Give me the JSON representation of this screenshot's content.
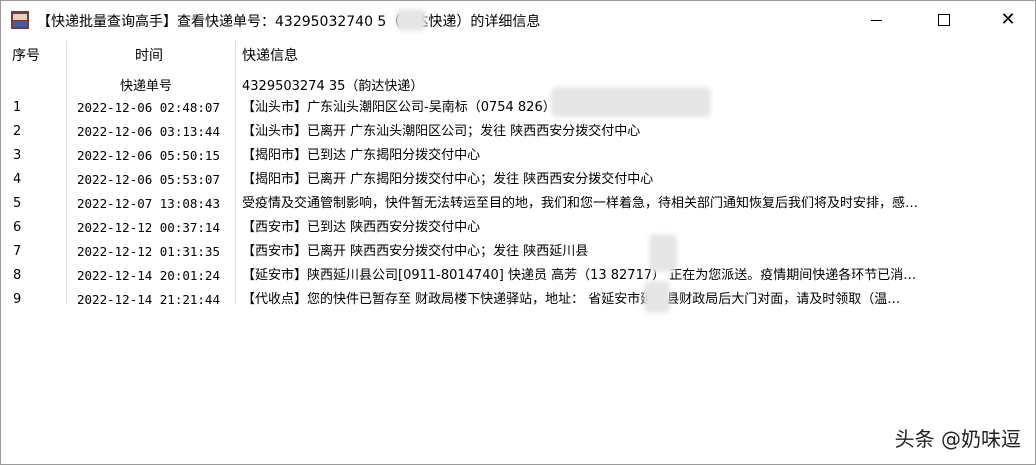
{
  "window": {
    "title": "【快递批量查询高手】查看快递单号：43295032740   5（韵达快递）的详细信息",
    "buttons": {
      "minimize": "minimize",
      "maximize": "maximize",
      "close": "✕"
    }
  },
  "table": {
    "headers": {
      "index": "序号",
      "time": "时间",
      "info": "快递信息"
    },
    "subheader": {
      "label": "快递单号",
      "value": "4329503274  35（韵达快递）"
    },
    "rows": [
      {
        "index": "1",
        "time": "2022-12-06 02:48:07",
        "info": "【汕头市】广东汕头潮阳区公司-吴南标（0754             826） 已揽收"
      },
      {
        "index": "2",
        "time": "2022-12-06 03:13:44",
        "info": "【汕头市】已离开 广东汕头潮阳区公司；发往 陕西西安分拨交付中心"
      },
      {
        "index": "3",
        "time": "2022-12-06 05:50:15",
        "info": "【揭阳市】已到达 广东揭阳分拨交付中心"
      },
      {
        "index": "4",
        "time": "2022-12-06 05:53:07",
        "info": "【揭阳市】已离开 广东揭阳分拨交付中心；发往 陕西西安分拨交付中心"
      },
      {
        "index": "5",
        "time": "2022-12-07 13:08:43",
        "info": "受疫情及交通管制影响，快件暂无法转运至目的地，我们和您一样着急，待相关部门通知恢复后我们将及时安排，感…"
      },
      {
        "index": "6",
        "time": "2022-12-12 00:37:14",
        "info": "【西安市】已到达 陕西西安分拨交付中心"
      },
      {
        "index": "7",
        "time": "2022-12-12 01:31:35",
        "info": "【西安市】已离开 陕西西安分拨交付中心；发往 陕西延川县"
      },
      {
        "index": "8",
        "time": "2022-12-14 20:01:24",
        "info": "【延安市】陕西延川县公司[0911-8014740] 快递员 高芳（13     82717） 正在为您派送。疫情期间快递各环节已消…"
      },
      {
        "index": "9",
        "time": "2022-12-14 21:21:44",
        "info": "【代收点】您的快件已暂存至 财政局楼下快递驿站，地址：     省延安市延川县财政局后大门对面，请及时领取（温…"
      }
    ]
  },
  "watermark": "头条 @奶味逗"
}
